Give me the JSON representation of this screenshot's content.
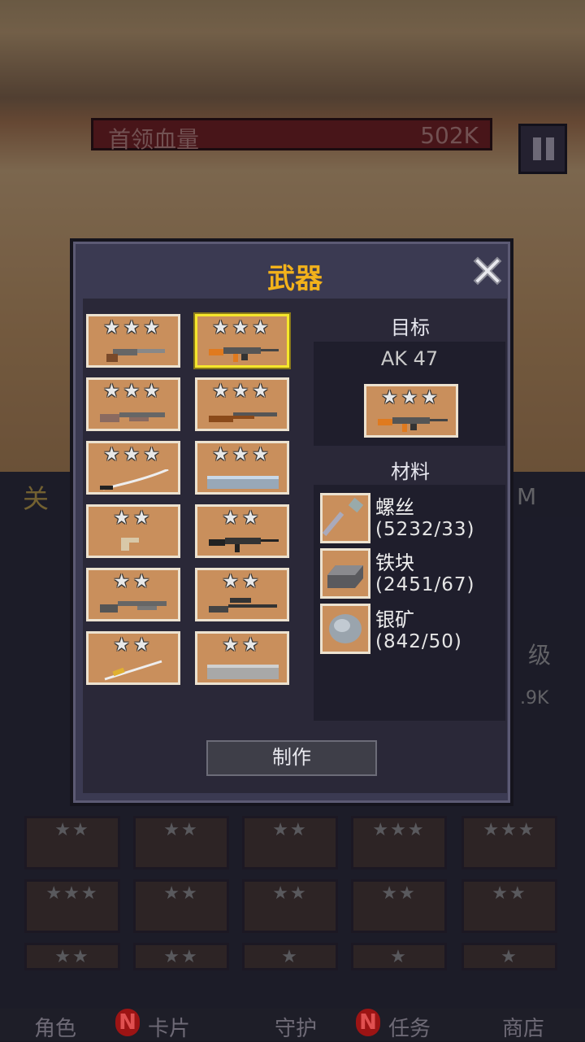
{
  "boss": {
    "label": "首领血量",
    "hp": "502K"
  },
  "background": {
    "stage_label": "关",
    "level_label": "级",
    "value_label": ".9K",
    "m_label": "M"
  },
  "dialog": {
    "title": "武器",
    "weapons": [
      {
        "stars": "★★★",
        "selected": false,
        "icon": "sawed-off-shotgun"
      },
      {
        "stars": "★★★",
        "selected": true,
        "icon": "ak47-rifle"
      },
      {
        "stars": "★★★",
        "selected": false,
        "icon": "pump-shotgun"
      },
      {
        "stars": "★★★",
        "selected": false,
        "icon": "hunting-rifle"
      },
      {
        "stars": "★★★",
        "selected": false,
        "icon": "katana"
      },
      {
        "stars": "★★★",
        "selected": false,
        "icon": "steel-bar"
      },
      {
        "stars": "★★",
        "selected": false,
        "icon": "revolver"
      },
      {
        "stars": "★★",
        "selected": false,
        "icon": "assault-rifle"
      },
      {
        "stars": "★★",
        "selected": false,
        "icon": "shotgun"
      },
      {
        "stars": "★★",
        "selected": false,
        "icon": "sniper-rifle"
      },
      {
        "stars": "★★",
        "selected": false,
        "icon": "sword"
      },
      {
        "stars": "★★",
        "selected": false,
        "icon": "metal-plate"
      }
    ],
    "target_label": "目标",
    "target_name": "AK 47",
    "target_stars": "★★★",
    "materials_label": "材料",
    "materials": [
      {
        "name": "螺丝",
        "count": "(5232/33)",
        "icon": "screw-icon"
      },
      {
        "name": "铁块",
        "count": "(2451/67)",
        "icon": "iron-ingot-icon"
      },
      {
        "name": "银矿",
        "count": "(842/50)",
        "icon": "silver-ore-icon"
      }
    ],
    "craft_label": "制作"
  },
  "bottom_nav": [
    {
      "label": "角色"
    },
    {
      "label": "卡片",
      "badge": "N"
    },
    {
      "label": "守护"
    },
    {
      "label": "任务",
      "badge": "N"
    },
    {
      "label": "商店"
    }
  ],
  "colors": {
    "title": "#f3b21b",
    "cell": "#c98f5c",
    "selected_border": "#f5e62c",
    "panel": "#3b3a52"
  }
}
